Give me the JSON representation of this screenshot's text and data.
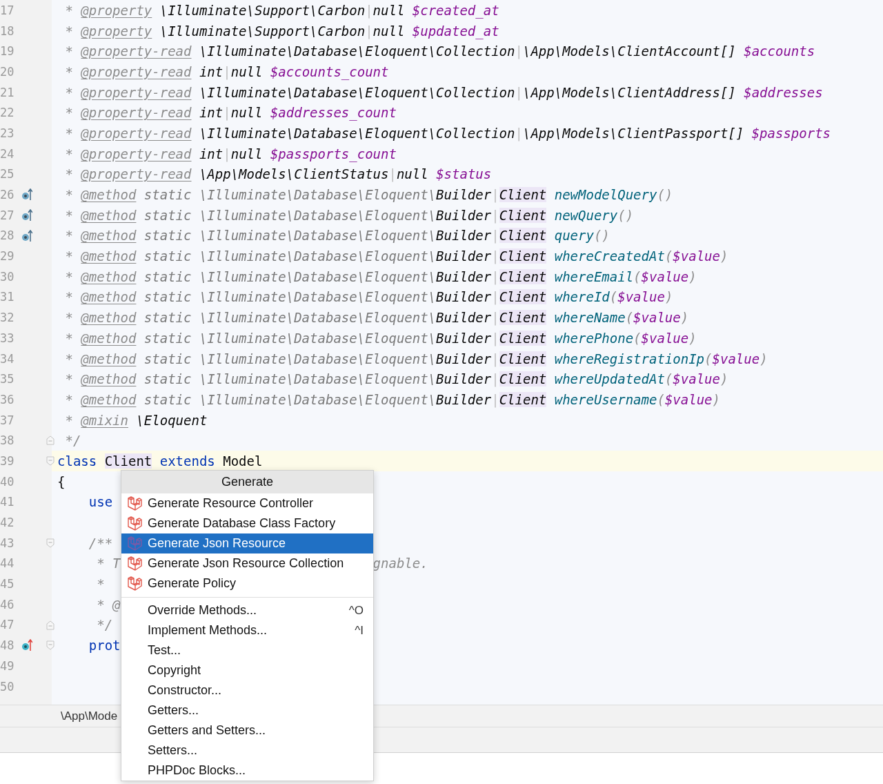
{
  "editor": {
    "lines": [
      {
        "number": "17",
        "tokens": [
          {
            "kind": "comment",
            "text": " * "
          },
          {
            "kind": "tag",
            "text": "@property"
          },
          {
            "kind": "type",
            "text": " \\Illuminate\\Support\\Carbon"
          },
          {
            "kind": "pipe",
            "text": "|"
          },
          {
            "kind": "type",
            "text": "null "
          },
          {
            "kind": "var",
            "text": "$created_at"
          }
        ]
      },
      {
        "number": "18",
        "tokens": [
          {
            "kind": "comment",
            "text": " * "
          },
          {
            "kind": "tag",
            "text": "@property"
          },
          {
            "kind": "type",
            "text": " \\Illuminate\\Support\\Carbon"
          },
          {
            "kind": "pipe",
            "text": "|"
          },
          {
            "kind": "type",
            "text": "null "
          },
          {
            "kind": "var",
            "text": "$updated_at"
          }
        ]
      },
      {
        "number": "19",
        "tokens": [
          {
            "kind": "comment",
            "text": " * "
          },
          {
            "kind": "tag",
            "text": "@property-read"
          },
          {
            "kind": "type",
            "text": " \\Illuminate\\Database\\Eloquent\\Collection"
          },
          {
            "kind": "pipe",
            "text": "|"
          },
          {
            "kind": "type",
            "text": "\\App\\Models\\ClientAccount[] "
          },
          {
            "kind": "var",
            "text": "$accounts"
          }
        ]
      },
      {
        "number": "20",
        "tokens": [
          {
            "kind": "comment",
            "text": " * "
          },
          {
            "kind": "tag",
            "text": "@property-read"
          },
          {
            "kind": "type",
            "text": " int"
          },
          {
            "kind": "pipe",
            "text": "|"
          },
          {
            "kind": "type",
            "text": "null "
          },
          {
            "kind": "var",
            "text": "$accounts_count"
          }
        ]
      },
      {
        "number": "21",
        "tokens": [
          {
            "kind": "comment",
            "text": " * "
          },
          {
            "kind": "tag",
            "text": "@property-read"
          },
          {
            "kind": "type",
            "text": " \\Illuminate\\Database\\Eloquent\\Collection"
          },
          {
            "kind": "pipe",
            "text": "|"
          },
          {
            "kind": "type",
            "text": "\\App\\Models\\ClientAddress[] "
          },
          {
            "kind": "var",
            "text": "$addresses"
          }
        ]
      },
      {
        "number": "22",
        "tokens": [
          {
            "kind": "comment",
            "text": " * "
          },
          {
            "kind": "tag",
            "text": "@property-read"
          },
          {
            "kind": "type",
            "text": " int"
          },
          {
            "kind": "pipe",
            "text": "|"
          },
          {
            "kind": "type",
            "text": "null "
          },
          {
            "kind": "var",
            "text": "$addresses_count"
          }
        ]
      },
      {
        "number": "23",
        "tokens": [
          {
            "kind": "comment",
            "text": " * "
          },
          {
            "kind": "tag",
            "text": "@property-read"
          },
          {
            "kind": "type",
            "text": " \\Illuminate\\Database\\Eloquent\\Collection"
          },
          {
            "kind": "pipe",
            "text": "|"
          },
          {
            "kind": "type",
            "text": "\\App\\Models\\ClientPassport[] "
          },
          {
            "kind": "var",
            "text": "$passports"
          }
        ]
      },
      {
        "number": "24",
        "tokens": [
          {
            "kind": "comment",
            "text": " * "
          },
          {
            "kind": "tag",
            "text": "@property-read"
          },
          {
            "kind": "type",
            "text": " int"
          },
          {
            "kind": "pipe",
            "text": "|"
          },
          {
            "kind": "type",
            "text": "null "
          },
          {
            "kind": "var",
            "text": "$passports_count"
          }
        ]
      },
      {
        "number": "25",
        "tokens": [
          {
            "kind": "comment",
            "text": " * "
          },
          {
            "kind": "tag",
            "text": "@property-read"
          },
          {
            "kind": "type",
            "text": " \\App\\Models\\ClientStatus"
          },
          {
            "kind": "pipe",
            "text": "|"
          },
          {
            "kind": "type",
            "text": "null "
          },
          {
            "kind": "var",
            "text": "$status"
          }
        ]
      },
      {
        "number": "26",
        "implemented": true,
        "tokens": [
          {
            "kind": "comment",
            "text": " * "
          },
          {
            "kind": "tag",
            "text": "@method"
          },
          {
            "kind": "muted",
            "text": " static \\Illuminate\\Database\\Eloquent\\"
          },
          {
            "kind": "type",
            "text": "Builder"
          },
          {
            "kind": "pipe",
            "text": "|"
          },
          {
            "kind": "type",
            "text": "Client",
            "highlighted": true
          },
          {
            "kind": "function",
            "text": " newModelQuery"
          },
          {
            "kind": "paren",
            "text": "()"
          }
        ]
      },
      {
        "number": "27",
        "implemented": true,
        "tokens": [
          {
            "kind": "comment",
            "text": " * "
          },
          {
            "kind": "tag",
            "text": "@method"
          },
          {
            "kind": "muted",
            "text": " static \\Illuminate\\Database\\Eloquent\\"
          },
          {
            "kind": "type",
            "text": "Builder"
          },
          {
            "kind": "pipe",
            "text": "|"
          },
          {
            "kind": "type",
            "text": "Client",
            "highlighted": true
          },
          {
            "kind": "function",
            "text": " newQuery"
          },
          {
            "kind": "paren",
            "text": "()"
          }
        ]
      },
      {
        "number": "28",
        "implemented": true,
        "tokens": [
          {
            "kind": "comment",
            "text": " * "
          },
          {
            "kind": "tag",
            "text": "@method"
          },
          {
            "kind": "muted",
            "text": " static \\Illuminate\\Database\\Eloquent\\"
          },
          {
            "kind": "type",
            "text": "Builder"
          },
          {
            "kind": "pipe",
            "text": "|"
          },
          {
            "kind": "type",
            "text": "Client",
            "highlighted": true
          },
          {
            "kind": "function",
            "text": " query"
          },
          {
            "kind": "paren",
            "text": "()"
          }
        ]
      },
      {
        "number": "29",
        "tokens": [
          {
            "kind": "comment",
            "text": " * "
          },
          {
            "kind": "tag",
            "text": "@method"
          },
          {
            "kind": "muted",
            "text": " static \\Illuminate\\Database\\Eloquent\\"
          },
          {
            "kind": "type",
            "text": "Builder"
          },
          {
            "kind": "pipe",
            "text": "|"
          },
          {
            "kind": "type",
            "text": "Client",
            "highlighted": true
          },
          {
            "kind": "function",
            "text": " whereCreatedAt"
          },
          {
            "kind": "paren",
            "text": "("
          },
          {
            "kind": "var",
            "text": "$value"
          },
          {
            "kind": "paren",
            "text": ")"
          }
        ]
      },
      {
        "number": "30",
        "tokens": [
          {
            "kind": "comment",
            "text": " * "
          },
          {
            "kind": "tag",
            "text": "@method"
          },
          {
            "kind": "muted",
            "text": " static \\Illuminate\\Database\\Eloquent\\"
          },
          {
            "kind": "type",
            "text": "Builder"
          },
          {
            "kind": "pipe",
            "text": "|"
          },
          {
            "kind": "type",
            "text": "Client",
            "highlighted": true
          },
          {
            "kind": "function",
            "text": " whereEmail"
          },
          {
            "kind": "paren",
            "text": "("
          },
          {
            "kind": "var",
            "text": "$value"
          },
          {
            "kind": "paren",
            "text": ")"
          }
        ]
      },
      {
        "number": "31",
        "tokens": [
          {
            "kind": "comment",
            "text": " * "
          },
          {
            "kind": "tag",
            "text": "@method"
          },
          {
            "kind": "muted",
            "text": " static \\Illuminate\\Database\\Eloquent\\"
          },
          {
            "kind": "type",
            "text": "Builder"
          },
          {
            "kind": "pipe",
            "text": "|"
          },
          {
            "kind": "type",
            "text": "Client",
            "highlighted": true
          },
          {
            "kind": "function",
            "text": " whereId"
          },
          {
            "kind": "paren",
            "text": "("
          },
          {
            "kind": "var",
            "text": "$value"
          },
          {
            "kind": "paren",
            "text": ")"
          }
        ]
      },
      {
        "number": "32",
        "tokens": [
          {
            "kind": "comment",
            "text": " * "
          },
          {
            "kind": "tag",
            "text": "@method"
          },
          {
            "kind": "muted",
            "text": " static \\Illuminate\\Database\\Eloquent\\"
          },
          {
            "kind": "type",
            "text": "Builder"
          },
          {
            "kind": "pipe",
            "text": "|"
          },
          {
            "kind": "type",
            "text": "Client",
            "highlighted": true
          },
          {
            "kind": "function",
            "text": " whereName"
          },
          {
            "kind": "paren",
            "text": "("
          },
          {
            "kind": "var",
            "text": "$value"
          },
          {
            "kind": "paren",
            "text": ")"
          }
        ]
      },
      {
        "number": "33",
        "tokens": [
          {
            "kind": "comment",
            "text": " * "
          },
          {
            "kind": "tag",
            "text": "@method"
          },
          {
            "kind": "muted",
            "text": " static \\Illuminate\\Database\\Eloquent\\"
          },
          {
            "kind": "type",
            "text": "Builder"
          },
          {
            "kind": "pipe",
            "text": "|"
          },
          {
            "kind": "type",
            "text": "Client",
            "highlighted": true
          },
          {
            "kind": "function",
            "text": " wherePhone"
          },
          {
            "kind": "paren",
            "text": "("
          },
          {
            "kind": "var",
            "text": "$value"
          },
          {
            "kind": "paren",
            "text": ")"
          }
        ]
      },
      {
        "number": "34",
        "tokens": [
          {
            "kind": "comment",
            "text": " * "
          },
          {
            "kind": "tag",
            "text": "@method"
          },
          {
            "kind": "muted",
            "text": " static \\Illuminate\\Database\\Eloquent\\"
          },
          {
            "kind": "type",
            "text": "Builder"
          },
          {
            "kind": "pipe",
            "text": "|"
          },
          {
            "kind": "type",
            "text": "Client",
            "highlighted": true
          },
          {
            "kind": "function",
            "text": " whereRegistrationIp"
          },
          {
            "kind": "paren",
            "text": "("
          },
          {
            "kind": "var",
            "text": "$value"
          },
          {
            "kind": "paren",
            "text": ")"
          }
        ]
      },
      {
        "number": "35",
        "tokens": [
          {
            "kind": "comment",
            "text": " * "
          },
          {
            "kind": "tag",
            "text": "@method"
          },
          {
            "kind": "muted",
            "text": " static \\Illuminate\\Database\\Eloquent\\"
          },
          {
            "kind": "type",
            "text": "Builder"
          },
          {
            "kind": "pipe",
            "text": "|"
          },
          {
            "kind": "type",
            "text": "Client",
            "highlighted": true
          },
          {
            "kind": "function",
            "text": " whereUpdatedAt"
          },
          {
            "kind": "paren",
            "text": "("
          },
          {
            "kind": "var",
            "text": "$value"
          },
          {
            "kind": "paren",
            "text": ")"
          }
        ]
      },
      {
        "number": "36",
        "tokens": [
          {
            "kind": "comment",
            "text": " * "
          },
          {
            "kind": "tag",
            "text": "@method"
          },
          {
            "kind": "muted",
            "text": " static \\Illuminate\\Database\\Eloquent\\"
          },
          {
            "kind": "type",
            "text": "Builder"
          },
          {
            "kind": "pipe",
            "text": "|"
          },
          {
            "kind": "type",
            "text": "Client",
            "highlighted": true
          },
          {
            "kind": "function",
            "text": " whereUsername"
          },
          {
            "kind": "paren",
            "text": "("
          },
          {
            "kind": "var",
            "text": "$value"
          },
          {
            "kind": "paren",
            "text": ")"
          }
        ]
      },
      {
        "number": "37",
        "tokens": [
          {
            "kind": "comment",
            "text": " * "
          },
          {
            "kind": "tag",
            "text": "@mixin"
          },
          {
            "kind": "type",
            "text": " \\Eloquent"
          }
        ]
      },
      {
        "number": "38",
        "fold_end": true,
        "tokens": [
          {
            "kind": "comment",
            "text": " */"
          }
        ]
      },
      {
        "number": "39",
        "fold_start": true,
        "current": true,
        "tokens": [
          {
            "kind": "keyword",
            "text": "class "
          },
          {
            "kind": "ident",
            "text": "Client",
            "highlighted": true
          },
          {
            "kind": "keyword",
            "text": " extends"
          },
          {
            "kind": "ident",
            "text": " Model"
          }
        ]
      },
      {
        "number": "40",
        "tokens": [
          {
            "kind": "ident",
            "text": "{"
          }
        ]
      },
      {
        "number": "41",
        "tokens": [
          {
            "kind": "keyword",
            "text": "    use"
          }
        ]
      },
      {
        "number": "42"
      },
      {
        "number": "43",
        "fold_start": true,
        "tokens": [
          {
            "kind": "comment",
            "text": "    /**"
          }
        ]
      },
      {
        "number": "44",
        "tokens": [
          {
            "kind": "comment",
            "text": "     * T"
          },
          {
            "kind": "comment",
            "text": "gnable.",
            "covered_before": true
          }
        ]
      },
      {
        "number": "45",
        "tokens": [
          {
            "kind": "comment",
            "text": "     *"
          }
        ]
      },
      {
        "number": "46",
        "tokens": [
          {
            "kind": "comment",
            "text": "     * @"
          }
        ]
      },
      {
        "number": "47",
        "fold_end": true,
        "tokens": [
          {
            "kind": "comment",
            "text": "     */"
          }
        ]
      },
      {
        "number": "48",
        "overrides": true,
        "fold_start": true,
        "tokens": [
          {
            "kind": "keyword",
            "text": "    prot"
          }
        ]
      },
      {
        "number": "49"
      },
      {
        "number": "50"
      }
    ]
  },
  "breadcrumb": "\\App\\Mode",
  "popup": {
    "title": "Generate",
    "sections": [
      {
        "items": [
          {
            "label": "Generate Resource Controller",
            "kind": "laravel",
            "selected": false
          },
          {
            "label": "Generate Database Class Factory",
            "kind": "laravel",
            "selected": false
          },
          {
            "label": "Generate Json Resource",
            "kind": "laravel",
            "selected": true
          },
          {
            "label": "Generate Json Resource Collection",
            "kind": "laravel",
            "selected": false
          },
          {
            "label": "Generate Policy",
            "kind": "laravel",
            "selected": false
          }
        ]
      },
      {
        "items": [
          {
            "label": "Override Methods...",
            "shortcut": "^O",
            "kind": "plain",
            "selected": false
          },
          {
            "label": "Implement Methods...",
            "shortcut": "^I",
            "kind": "plain",
            "selected": false
          },
          {
            "label": "Test...",
            "kind": "plain",
            "selected": false
          },
          {
            "label": "Copyright",
            "kind": "plain",
            "selected": false
          },
          {
            "label": "Constructor...",
            "kind": "plain",
            "selected": false
          },
          {
            "label": "Getters...",
            "kind": "plain",
            "selected": false
          },
          {
            "label": "Getters and Setters...",
            "kind": "plain",
            "selected": false
          },
          {
            "label": "Setters...",
            "kind": "plain",
            "selected": false
          },
          {
            "label": "PHPDoc Blocks...",
            "kind": "plain",
            "selected": false
          }
        ]
      }
    ]
  }
}
